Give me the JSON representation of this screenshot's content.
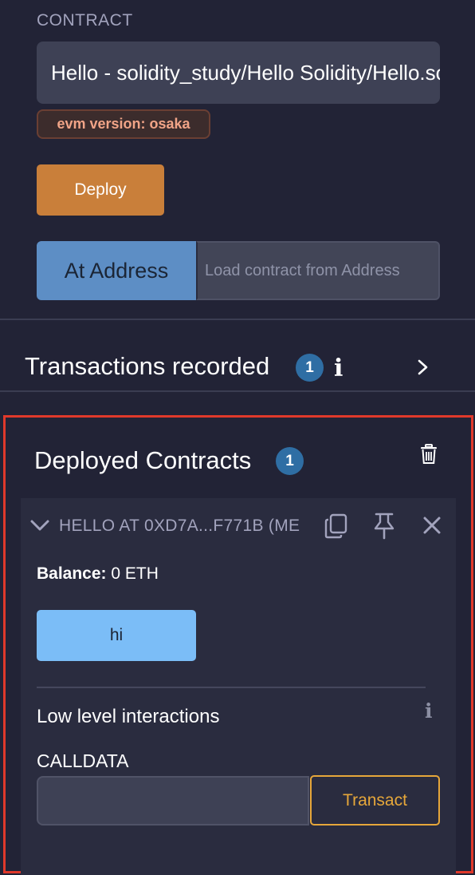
{
  "contract_section": {
    "label": "CONTRACT",
    "selected_contract": "Hello - solidity_study/Hello Solidity/Hello.sol",
    "evm_badge": "evm version: osaka",
    "deploy_label": "Deploy",
    "at_address_label": "At Address",
    "address_placeholder": "Load contract from Address"
  },
  "transactions": {
    "title": "Transactions recorded",
    "count": "1",
    "info_glyph": "i"
  },
  "deployed": {
    "title": "Deployed Contracts",
    "count": "1",
    "instance": {
      "name": "HELLO AT 0XD7A...F771B (ME",
      "balance_label": "Balance:",
      "balance_value": " 0 ETH",
      "function_label": "hi"
    },
    "low_level": {
      "title": "Low level interactions",
      "info_glyph": "i",
      "calldata_label": "CALLDATA",
      "calldata_value": "",
      "transact_label": "Transact"
    }
  },
  "icons": [
    "chevron-right-icon",
    "trash-icon",
    "chevron-down-icon",
    "copy-icon",
    "pin-icon",
    "close-icon",
    "info-icon"
  ],
  "colors": {
    "background": "#222336",
    "deploy": "#c97f3a",
    "at_address": "#5d8ec5",
    "call_button": "#7bbdf7",
    "transact": "#e6a73a",
    "badge": "#2f6ea4",
    "highlight": "#e0392b"
  }
}
